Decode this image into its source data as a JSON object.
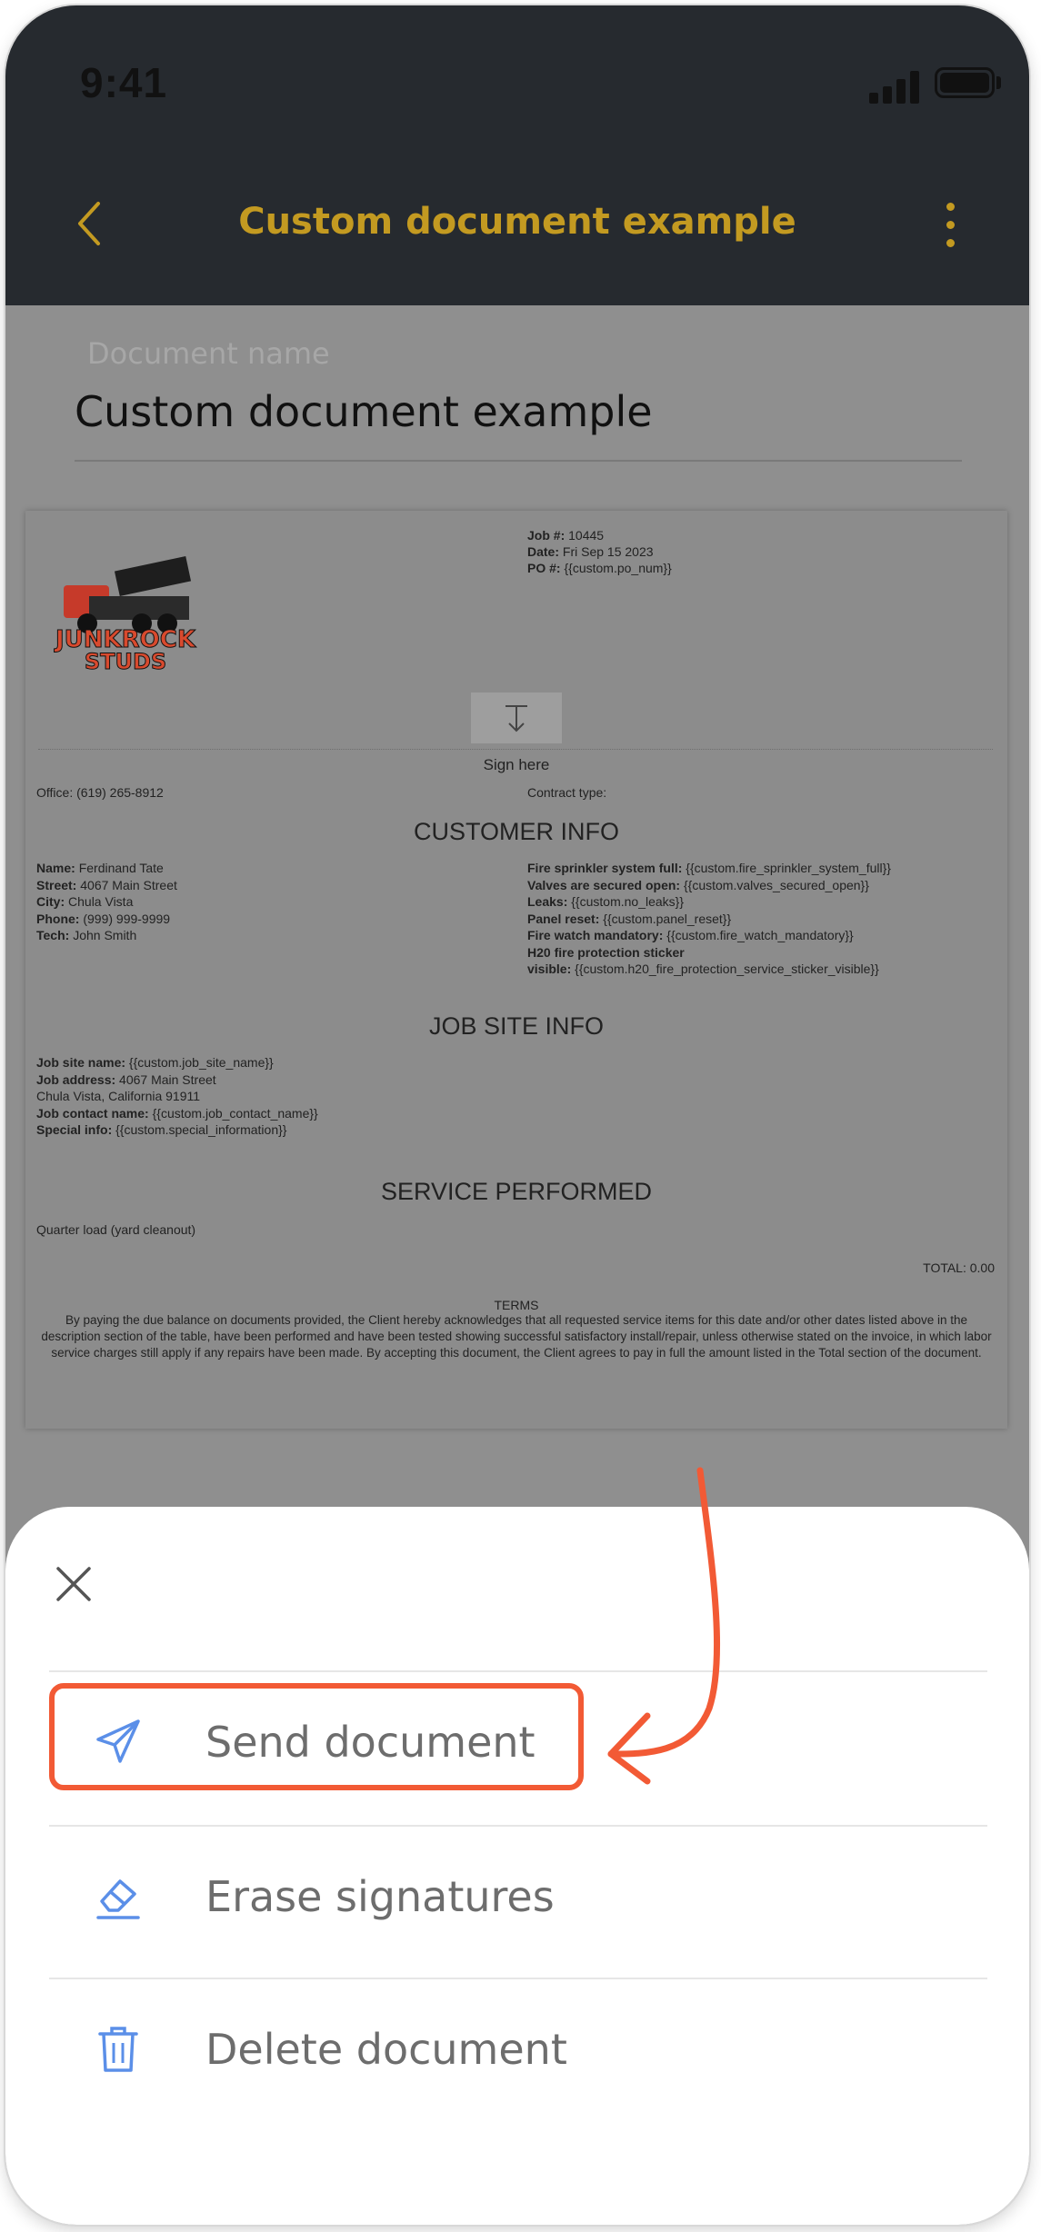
{
  "status": {
    "time": "9:41"
  },
  "nav": {
    "title": "Custom document example"
  },
  "field": {
    "label": "Document name",
    "value": "Custom document example"
  },
  "document": {
    "logo_text": [
      "JUNKROCK",
      "STUDS"
    ],
    "job_label": "Job #:",
    "job_value": "10445",
    "date_label": "Date:",
    "date_value": "Fri Sep 15 2023",
    "po_label": "PO #:",
    "po_value": "{{custom.po_num}}",
    "sign_here": "Sign here",
    "office": "Office: (619) 265-8912",
    "contract_type": "Contract type:",
    "customer_title": "CUSTOMER INFO",
    "customer_left": [
      {
        "k": "Name:",
        "v": "Ferdinand Tate"
      },
      {
        "k": "Street:",
        "v": "4067 Main Street"
      },
      {
        "k": "City:",
        "v": "Chula Vista"
      },
      {
        "k": "Phone:",
        "v": "(999) 999-9999"
      },
      {
        "k": "Tech:",
        "v": "John Smith"
      }
    ],
    "customer_right": [
      {
        "k": "Fire sprinkler system full:",
        "v": "{{custom.fire_sprinkler_system_full}}"
      },
      {
        "k": "Valves are secured open:",
        "v": "{{custom.valves_secured_open}}"
      },
      {
        "k": "Leaks:",
        "v": "{{custom.no_leaks}}"
      },
      {
        "k": "Panel reset:",
        "v": "{{custom.panel_reset}}"
      },
      {
        "k": "Fire watch mandatory:",
        "v": "{{custom.fire_watch_mandatory}}"
      },
      {
        "k": "H20 fire protection sticker",
        "v": ""
      },
      {
        "k": "visible:",
        "v": "{{custom.h20_fire_protection_service_sticker_visible}}"
      }
    ],
    "jobsite_title": "JOB SITE INFO",
    "jobsite": [
      {
        "k": "Job site name:",
        "v": "{{custom.job_site_name}}"
      },
      {
        "k": "Job address:",
        "v": "4067 Main Street"
      },
      {
        "k": "",
        "v": "Chula Vista, California 91911"
      },
      {
        "k": "Job contact name:",
        "v": "{{custom.job_contact_name}}"
      },
      {
        "k": "Special info:",
        "v": "{{custom.special_information}}"
      }
    ],
    "service_title": "SERVICE PERFORMED",
    "service_line": "Quarter load (yard cleanout)",
    "total": "TOTAL: 0.00",
    "terms_title": "TERMS",
    "terms_text": "By paying the due balance on documents provided, the Client hereby acknowledges that all requested service items for this date and/or other dates listed above in the description section of the table, have been performed and have been tested showing successful satisfactory install/repair, unless otherwise stated on the invoice, in which labor service charges still apply if any repairs have been made. By accepting this document, the Client agrees to pay in full the amount listed in the Total section of the document."
  },
  "sheet": {
    "items": [
      {
        "label": "Send document",
        "icon": "paper-plane-icon"
      },
      {
        "label": "Erase signatures",
        "icon": "eraser-icon"
      },
      {
        "label": "Delete document",
        "icon": "trash-icon"
      }
    ]
  },
  "colors": {
    "topbar": "#262a2f",
    "title": "#c39a21",
    "highlight": "#f25a35",
    "icon": "#5b8fe8"
  }
}
